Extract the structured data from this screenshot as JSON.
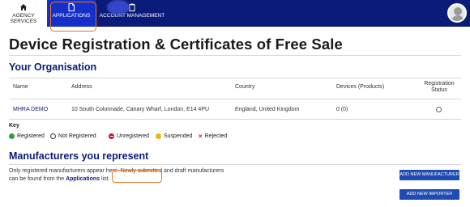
{
  "nav": {
    "items": [
      {
        "label": "AGENCY SERVICES",
        "icon": "home-icon"
      },
      {
        "label": "APPLICATIONS",
        "icon": "document-icon"
      },
      {
        "label": "ACCOUNT MANAGEMENT",
        "icon": "clipboard-icon"
      }
    ]
  },
  "page": {
    "title": "Device Registration & Certificates of Free Sale"
  },
  "organisation": {
    "heading": "Your Organisation",
    "columns": [
      "Name",
      "Address",
      "Country",
      "Devices (Products)",
      "Registration Status"
    ],
    "row": {
      "name": "MHRA DEMO",
      "address": "10 South Colonnade, Canary Wharf, London, E14 4PU",
      "country": "England, United Kingdom",
      "devices": "0 (0)"
    }
  },
  "key": {
    "title": "Key",
    "items": [
      {
        "label": "Registered",
        "icon": "registered-dot-icon",
        "color": "#2e9e3a"
      },
      {
        "label": "Not Registered",
        "icon": "not-registered-dot-icon",
        "color": "#ffffff"
      },
      {
        "label": "Unregistered",
        "icon": "unregistered-dot-icon",
        "color": "#c8102e"
      },
      {
        "label": "Suspended",
        "icon": "suspended-dot-icon",
        "color": "#f2b705"
      },
      {
        "label": "Rejected",
        "icon": "rejected-x-icon",
        "color": "#c8102e"
      }
    ]
  },
  "manufacturers": {
    "heading": "Manufacturers you represent",
    "text_1": "Only registered manufacturers appear here. Newly submitted and draft manufacturers can be found from the",
    "link": "Applications",
    "text_2": "list.",
    "add_manufacturer_button": "ADD NEW MANUFACTURER",
    "add_importer_button": "ADD NEW IMPORTER"
  },
  "colors": {
    "nav_bg": "#0b1b7a",
    "nav_active": "#1430c8",
    "heading": "#0b1b7a",
    "highlight": "#e87722",
    "button": "#1f4bb3"
  }
}
